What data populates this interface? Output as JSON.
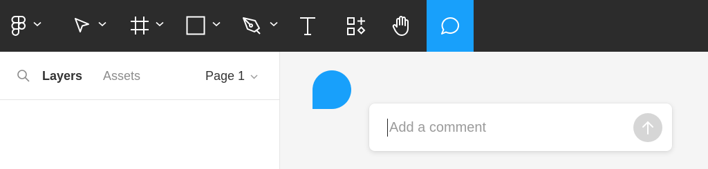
{
  "toolbar": {
    "tools": [
      {
        "name": "main-menu",
        "icon": "figma-logo-icon"
      },
      {
        "name": "move-tool",
        "icon": "cursor-arrow-icon"
      },
      {
        "name": "frame-tool",
        "icon": "frame-hash-icon"
      },
      {
        "name": "shape-tool",
        "icon": "rectangle-icon"
      },
      {
        "name": "pen-tool",
        "icon": "pen-nib-icon"
      },
      {
        "name": "text-tool",
        "icon": "text-t-icon"
      },
      {
        "name": "resources-tool",
        "icon": "components-plus-icon"
      },
      {
        "name": "hand-tool",
        "icon": "hand-icon"
      },
      {
        "name": "comment-tool",
        "icon": "speech-bubble-icon",
        "active": true
      }
    ],
    "active_color": "#18a0fb",
    "background": "#2c2c2c"
  },
  "left_panel": {
    "tabs": [
      {
        "label": "Layers",
        "active": true
      },
      {
        "label": "Assets",
        "active": false
      }
    ],
    "page_selector": {
      "label": "Page 1"
    }
  },
  "canvas": {
    "comment": {
      "placeholder": "Add a comment",
      "value": "",
      "submit_icon": "arrow-up-icon"
    }
  }
}
